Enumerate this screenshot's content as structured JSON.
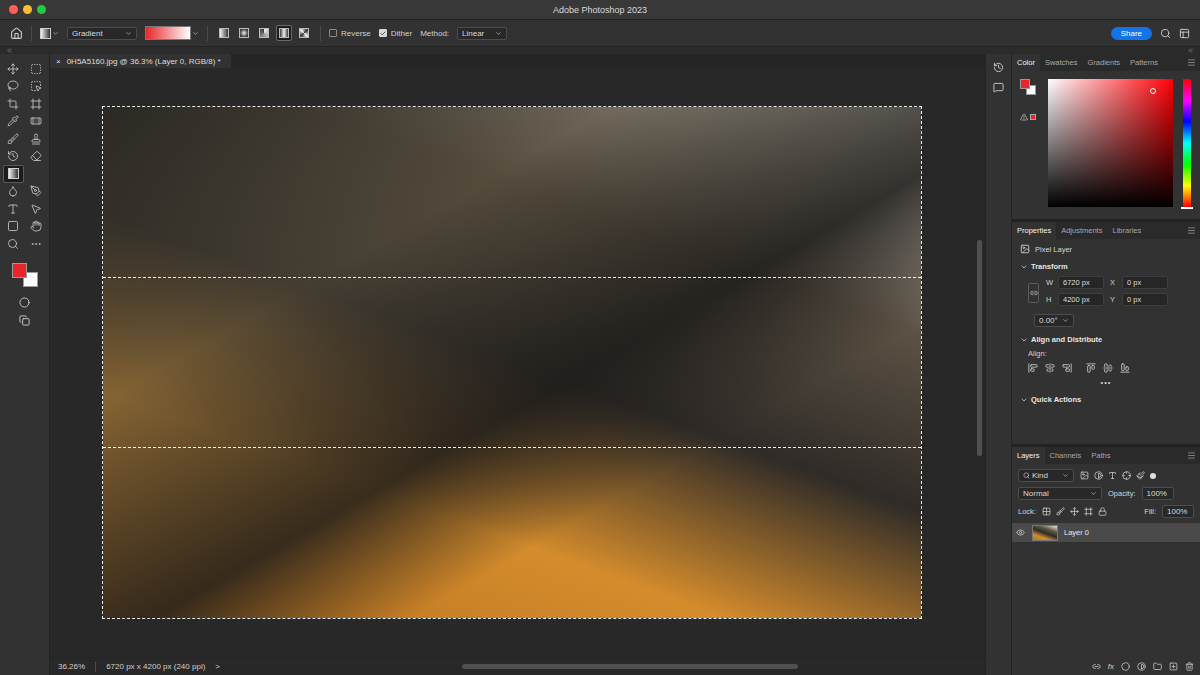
{
  "window": {
    "title": "Adobe Photoshop 2023",
    "buttons": [
      {
        "name": "close",
        "color": "#fe5f57"
      },
      {
        "name": "minimize",
        "color": "#febc2e"
      },
      {
        "name": "zoom",
        "color": "#28c840"
      }
    ]
  },
  "options_bar": {
    "preset": "Gradient",
    "gradient_types": [
      {
        "kind": "linear",
        "selected": false
      },
      {
        "kind": "radial",
        "selected": false
      },
      {
        "kind": "angle",
        "selected": false
      },
      {
        "kind": "reflected",
        "selected": true
      },
      {
        "kind": "diamond",
        "selected": false
      }
    ],
    "checkboxes": [
      {
        "label": "Reverse",
        "checked": false
      },
      {
        "label": "Dither",
        "checked": true
      }
    ],
    "method_label": "Method:",
    "method": "Linear",
    "share": "Share"
  },
  "tools": [
    {
      "kind": "move",
      "selected": false
    },
    {
      "kind": "marquee",
      "selected": false
    },
    {
      "kind": "lasso",
      "selected": false
    },
    {
      "kind": "object-select",
      "selected": false
    },
    {
      "kind": "crop",
      "selected": false
    },
    {
      "kind": "frame",
      "selected": false
    },
    {
      "kind": "eyedropper",
      "selected": false
    },
    {
      "kind": "healing",
      "selected": false
    },
    {
      "kind": "brush",
      "selected": false
    },
    {
      "kind": "stamp",
      "selected": false
    },
    {
      "kind": "history-brush",
      "selected": false
    },
    {
      "kind": "eraser",
      "selected": false
    },
    {
      "kind": "gradient",
      "selected": true
    },
    {
      "kind": "empty",
      "selected": false
    },
    {
      "kind": "blur",
      "selected": false
    },
    {
      "kind": "pen",
      "selected": false
    },
    {
      "kind": "type",
      "selected": false
    },
    {
      "kind": "path-select",
      "selected": false
    },
    {
      "kind": "rectangle",
      "selected": false
    },
    {
      "kind": "hand",
      "selected": false
    },
    {
      "kind": "zoom",
      "selected": false
    },
    {
      "kind": "more",
      "selected": false
    }
  ],
  "colors": {
    "foreground": "#e8262a",
    "background": "#ffffff"
  },
  "document": {
    "close": "×",
    "title": "0H5A5160.jpg @ 36.3% (Layer 0, RGB/8) *",
    "selection": {
      "active": true,
      "bands": 3
    }
  },
  "scrollbars": {
    "vertical": {
      "offset": 0.29,
      "level": 0.37
    },
    "horizontal": {
      "offset": 0.31,
      "level": 0.45
    }
  },
  "status_bar": {
    "zoom": "36.26%",
    "info": "6720 px x 4200 px (240 ppi)",
    "arrow": ">"
  },
  "color_panel": {
    "tabs": [
      {
        "label": "Color",
        "selected": true
      },
      {
        "label": "Swatches",
        "selected": false
      },
      {
        "label": "Gradients",
        "selected": false
      },
      {
        "label": "Patterns",
        "selected": false
      }
    ]
  },
  "properties": {
    "tabs": [
      {
        "label": "Properties",
        "selected": true
      },
      {
        "label": "Adjustments",
        "selected": false
      },
      {
        "label": "Libraries",
        "selected": false
      }
    ],
    "layer_kind": "Pixel Layer",
    "sections": [
      {
        "kind": "transform",
        "title": "Transform",
        "expanded": true
      },
      {
        "kind": "align",
        "title": "Align and Distribute",
        "expanded": true
      },
      {
        "kind": "quick",
        "title": "Quick Actions",
        "expanded": true
      }
    ],
    "transform": {
      "fields": [
        {
          "label": "W",
          "value": "6720 px"
        },
        {
          "label": "X",
          "value": "0 px"
        },
        {
          "label": "H",
          "value": "4200 px"
        },
        {
          "label": "Y",
          "value": "0 px"
        }
      ],
      "angle": "0.00°"
    },
    "align": {
      "label": "Align:",
      "more": "•••"
    }
  },
  "layers_panel": {
    "tabs": [
      {
        "label": "Layers",
        "selected": true
      },
      {
        "label": "Channels",
        "selected": false
      },
      {
        "label": "Paths",
        "selected": false
      }
    ],
    "filter": "Kind",
    "blend_mode": "Normal",
    "opacity_label": "Opacity:",
    "opacity": "100%",
    "lock_label": "Lock:",
    "fill_label": "Fill:",
    "fill": "100%",
    "layers": [
      {
        "name": "Layer 0",
        "visible": true,
        "selected": true
      }
    ],
    "fx": "fx"
  }
}
